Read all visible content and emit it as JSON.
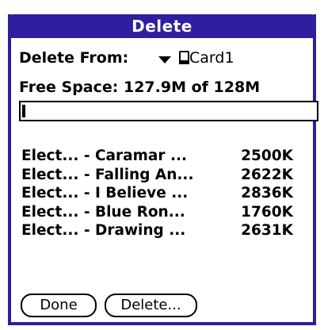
{
  "dialog": {
    "title": "Delete"
  },
  "source": {
    "label": "Delete From:",
    "selected": "Card1"
  },
  "free_space": {
    "text": "Free Space: 127.9M of 128M",
    "used_fraction": 0.01
  },
  "files": [
    {
      "name": "Elect... - Caramar ...",
      "size": "2500K"
    },
    {
      "name": "Elect... - Falling An...",
      "size": "2622K"
    },
    {
      "name": "Elect... - I Believe ...",
      "size": "2836K"
    },
    {
      "name": "Elect... - Blue Ron...",
      "size": "1760K"
    },
    {
      "name": "Elect... - Drawing ...",
      "size": "2631K"
    }
  ],
  "buttons": {
    "done": "Done",
    "delete": "Delete..."
  },
  "colors": {
    "title_bar": "#2e1fa0",
    "frame": "#2e1fa0"
  },
  "icons": {
    "dropdown": "triangle-down-icon",
    "card": "memory-card-icon"
  }
}
